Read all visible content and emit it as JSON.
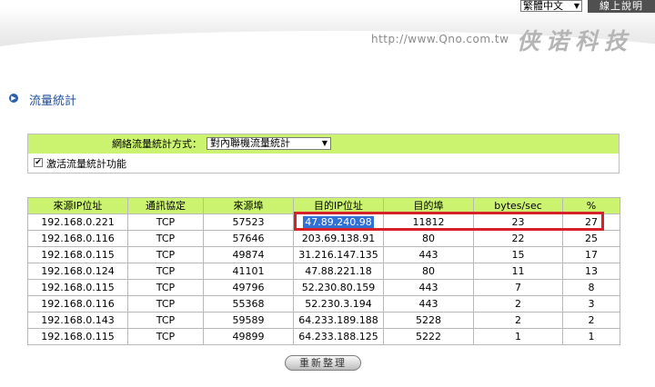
{
  "header": {
    "language": "繁體中文",
    "help_label": "線上說明",
    "url": "http://www.Qno.com.tw",
    "brand": "侠诺科技"
  },
  "page": {
    "title": "流量統計"
  },
  "settings": {
    "mode_label": "網絡流量統計方式：",
    "mode_value": "對內聯機流量統計",
    "enable_label": "激活流量統計功能",
    "enable_checked": true
  },
  "table": {
    "headers": [
      "來源IP位址",
      "通訊協定",
      "來源埠",
      "目的IP位址",
      "目的埠",
      "bytes/sec",
      "%"
    ],
    "rows": [
      [
        "192.168.0.221",
        "TCP",
        "57523",
        "47.89.240.98",
        "11812",
        "23",
        "27"
      ],
      [
        "192.168.0.116",
        "TCP",
        "57646",
        "203.69.138.91",
        "80",
        "22",
        "25"
      ],
      [
        "192.168.0.115",
        "TCP",
        "49874",
        "31.216.147.135",
        "443",
        "15",
        "17"
      ],
      [
        "192.168.0.124",
        "TCP",
        "41101",
        "47.88.221.18",
        "80",
        "11",
        "13"
      ],
      [
        "192.168.0.115",
        "TCP",
        "49796",
        "52.230.80.159",
        "443",
        "7",
        "8"
      ],
      [
        "192.168.0.116",
        "TCP",
        "55368",
        "52.230.3.194",
        "443",
        "2",
        "3"
      ],
      [
        "192.168.0.143",
        "TCP",
        "59589",
        "64.233.189.188",
        "5228",
        "2",
        "2"
      ],
      [
        "192.168.0.115",
        "TCP",
        "49899",
        "64.233.188.125",
        "5222",
        "1",
        "1"
      ]
    ]
  },
  "actions": {
    "refresh_label": "重新整理"
  },
  "colors": {
    "header_green": "#ccf36f",
    "title_blue": "#1f4e9a",
    "highlight_red": "#d8202a",
    "selection_blue": "#3370d4"
  }
}
